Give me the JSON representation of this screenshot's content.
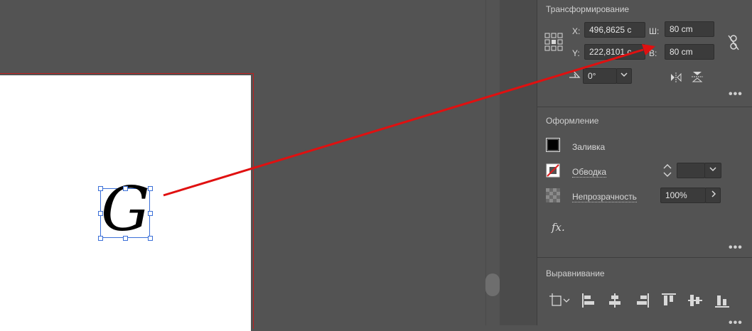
{
  "transform": {
    "title": "Трансформирование",
    "x_label": "X:",
    "x_value": "496,8625 с",
    "y_label": "Y:",
    "y_value": "222,8101 с",
    "w_label": "Ш:",
    "w_value": "80 cm",
    "h_label": "В:",
    "h_value": "80 cm",
    "angle_value": "0°"
  },
  "appearance": {
    "title": "Оформление",
    "fill_label": "Заливка",
    "stroke_label": "Обводка",
    "opacity_label": "Непрозрачность",
    "opacity_value": "100%",
    "fx_label": "fx."
  },
  "align": {
    "title": "Выравнивание"
  },
  "canvas": {
    "glyph": "G"
  },
  "colors": {
    "arrow": "#e01010",
    "selection": "#3a6fd8"
  }
}
